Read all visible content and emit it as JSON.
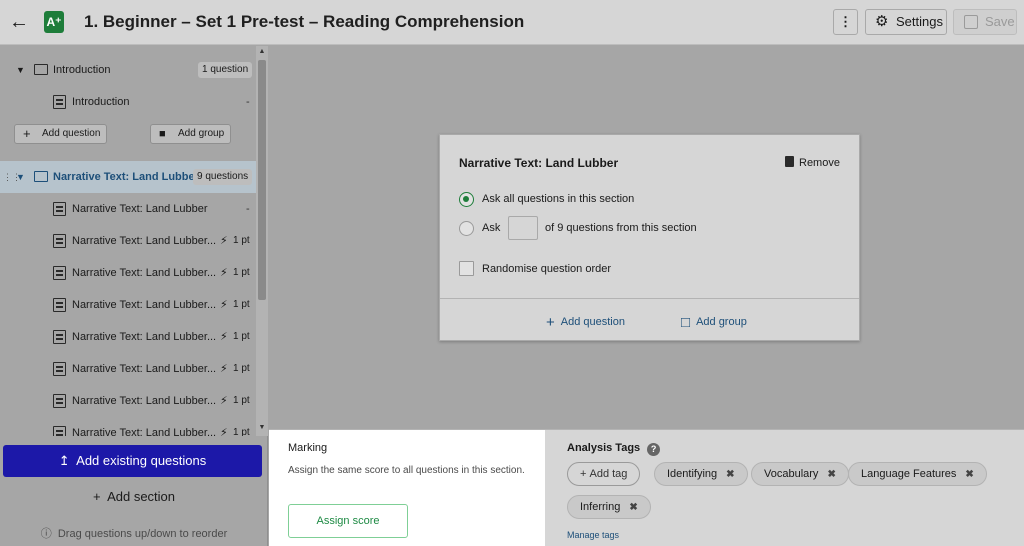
{
  "header": {
    "back_icon": "arrow-left-icon",
    "logo_text": "A⁺",
    "title": "1. Beginner – Set 1 Pre-test – Reading Comprehension",
    "more_label": "⋮",
    "settings_label": "Settings",
    "save_label": "Save"
  },
  "sidebar": {
    "sections": [
      {
        "title": "Introduction",
        "badge": "1 question",
        "items": [
          {
            "label": "Introduction",
            "points": "-"
          }
        ],
        "add_question_label": "Add question",
        "add_group_label": "Add group"
      },
      {
        "title": "Narrative Text: Land Lubber",
        "badge": "9 questions",
        "items": [
          {
            "label": "Narrative Text: Land Lubber",
            "points": "-"
          },
          {
            "label": "Narrative Text: Land Lubber...",
            "points": "1 pt"
          },
          {
            "label": "Narrative Text: Land Lubber...",
            "points": "1 pt"
          },
          {
            "label": "Narrative Text: Land Lubber...",
            "points": "1 pt"
          },
          {
            "label": "Narrative Text: Land Lubber...",
            "points": "1 pt"
          },
          {
            "label": "Narrative Text: Land Lubber...",
            "points": "1 pt"
          },
          {
            "label": "Narrative Text: Land Lubber...",
            "points": "1 pt"
          },
          {
            "label": "Narrative Text: Land Lubber...",
            "points": "1 pt"
          }
        ]
      }
    ],
    "add_existing_label": "Add existing questions",
    "add_section_label": "Add section",
    "hint": "Drag questions up/down to reorder"
  },
  "card": {
    "title": "Narrative Text: Land Lubber",
    "remove_label": "Remove",
    "option_all": "Ask all questions in this section",
    "option_ask": "Ask",
    "option_ask_suffix": "of 9 questions from this section",
    "ask_count": "",
    "randomise_label": "Randomise question order",
    "add_question_label": "Add question",
    "add_group_label": "Add group",
    "selected_option": "all"
  },
  "marking": {
    "heading": "Marking",
    "description": "Assign the same score to all questions in this section.",
    "assign_label": "Assign score"
  },
  "tags": {
    "heading": "Analysis Tags",
    "add_tag_label": "Add tag",
    "items": [
      "Identifying",
      "Vocabulary",
      "Language Features",
      "Inferring"
    ],
    "manage_label": "Manage tags"
  },
  "colors": {
    "accent_green": "#1e7d3a",
    "primary_blue": "#1c18a8",
    "link_blue": "#1d4f79"
  }
}
